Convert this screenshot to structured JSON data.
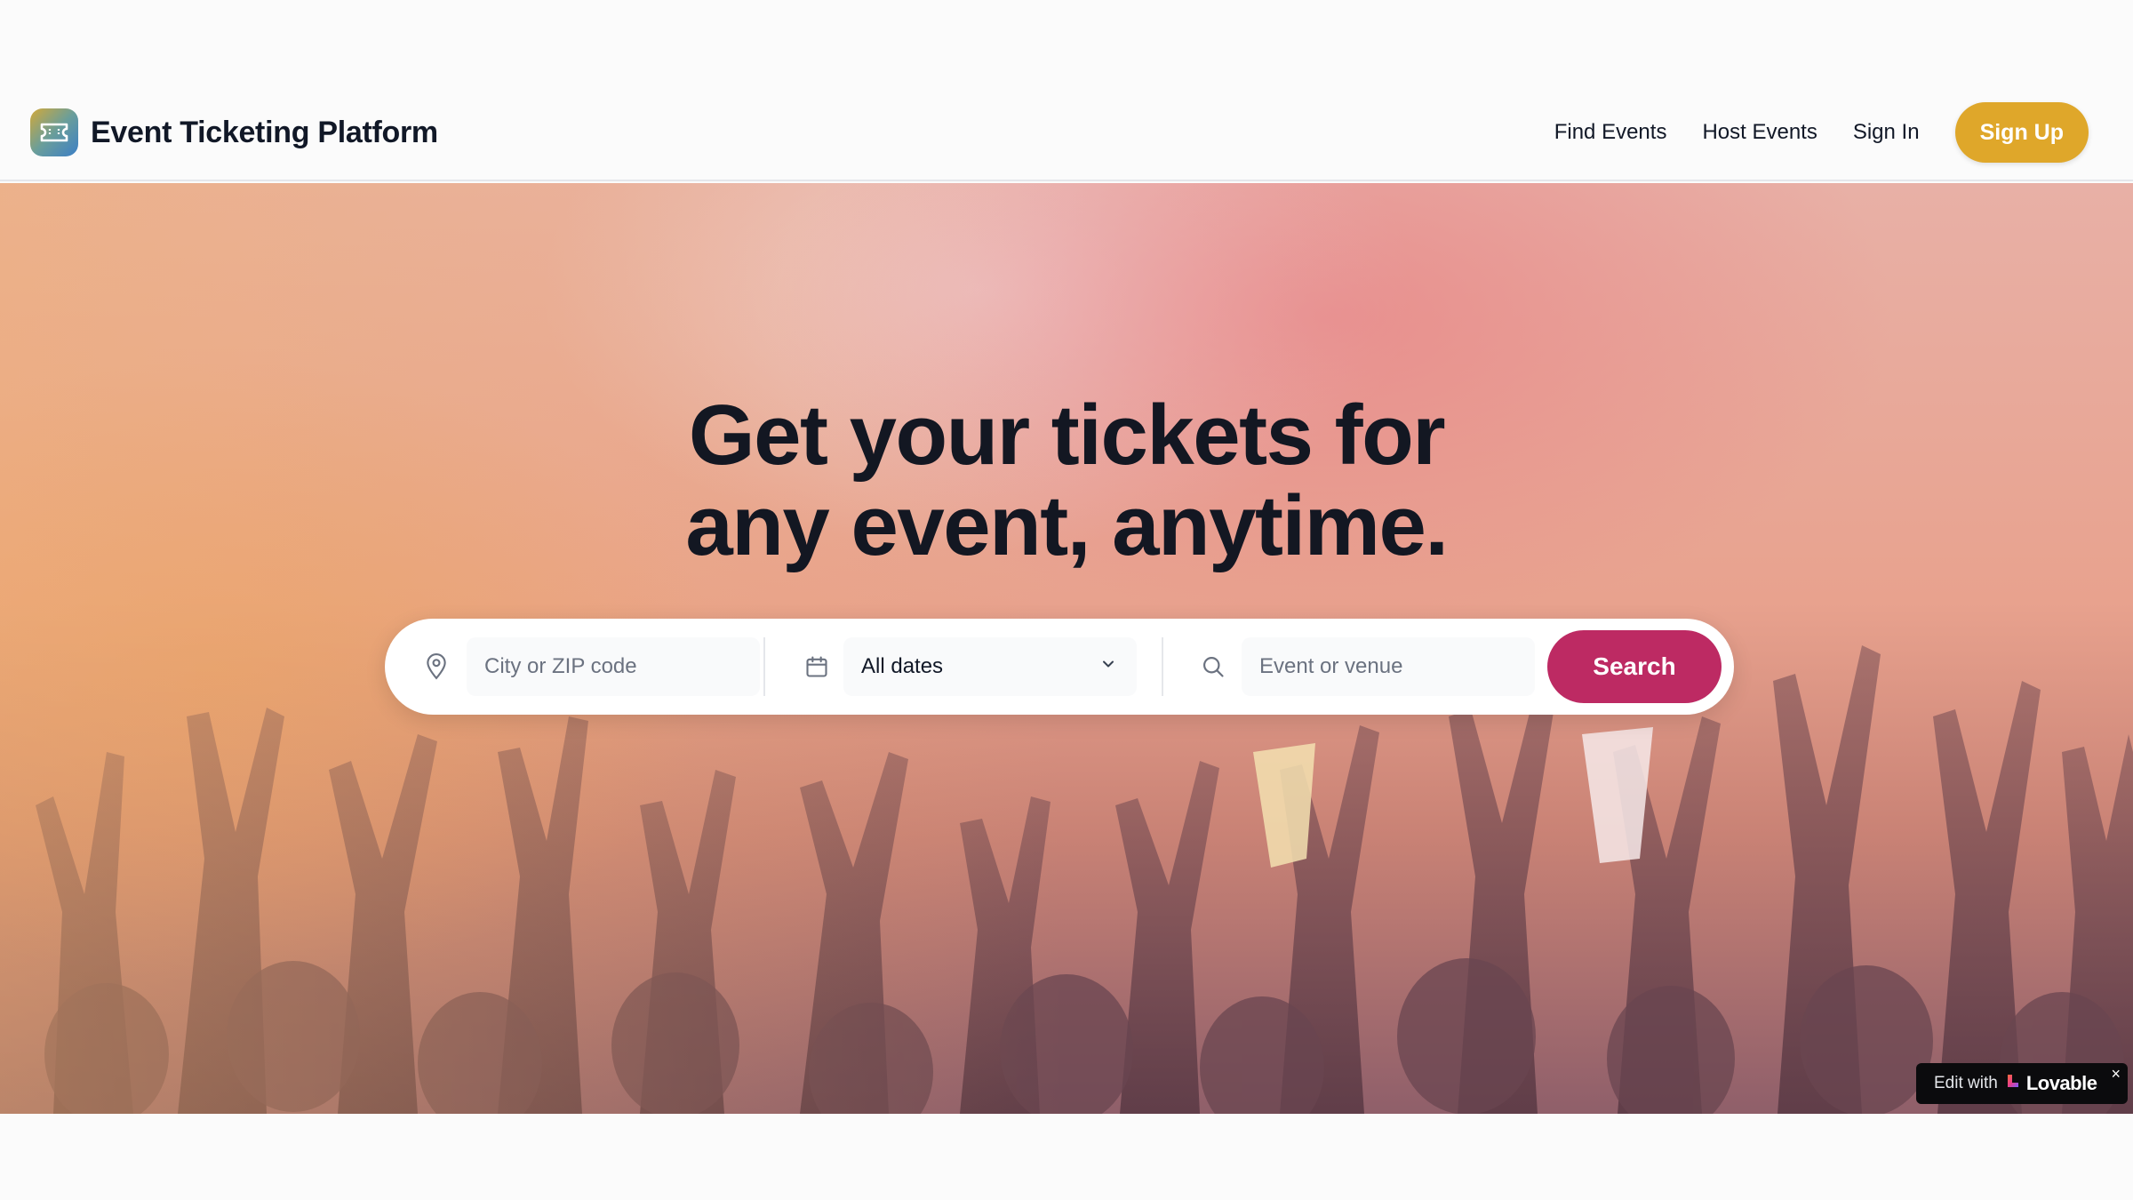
{
  "header": {
    "brand_name": "Event Ticketing Platform",
    "logo_icon": "ticket-icon",
    "nav": {
      "find_events": "Find Events",
      "host_events": "Host Events",
      "sign_in": "Sign In",
      "sign_up": "Sign Up"
    }
  },
  "hero": {
    "headline_line1": "Get your tickets for",
    "headline_line2": "any event, anytime.",
    "background_image": "concert-crowd-hands-raised"
  },
  "search": {
    "location_placeholder": "City or ZIP code",
    "location_icon": "map-pin-icon",
    "date_icon": "calendar-icon",
    "date_value": "All dates",
    "query_icon": "search-icon",
    "query_placeholder": "Event or venue",
    "button_label": "Search"
  },
  "badge": {
    "prefix": "Edit with",
    "brand": "Lovable",
    "close": "×"
  },
  "colors": {
    "accent_signup": "#dfa72a",
    "accent_search": "#bd2a63",
    "text_dark": "#111827"
  }
}
